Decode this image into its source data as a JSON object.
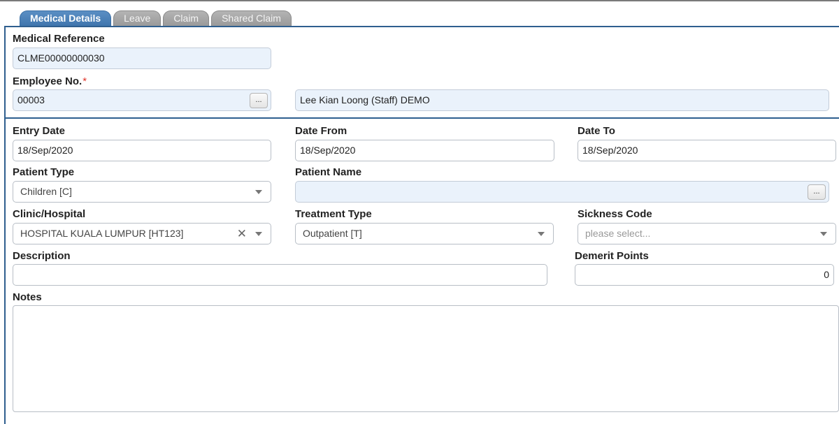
{
  "tabs": [
    {
      "label": "Medical Details",
      "active": true
    },
    {
      "label": "Leave",
      "active": false
    },
    {
      "label": "Claim",
      "active": false
    },
    {
      "label": "Shared Claim",
      "active": false
    }
  ],
  "form": {
    "medical_reference": {
      "label": "Medical Reference",
      "value": "CLME00000000030"
    },
    "employee_no": {
      "label": "Employee No.",
      "required_mark": "*",
      "value": "00003",
      "lookup_label": "...",
      "name_value": "Lee Kian Loong (Staff) DEMO"
    },
    "entry_date": {
      "label": "Entry Date",
      "value": "18/Sep/2020"
    },
    "date_from": {
      "label": "Date From",
      "value": "18/Sep/2020"
    },
    "date_to": {
      "label": "Date To",
      "value": "18/Sep/2020"
    },
    "patient_type": {
      "label": "Patient Type",
      "value": "Children [C]"
    },
    "patient_name": {
      "label": "Patient Name",
      "value": "",
      "lookup_label": "..."
    },
    "clinic_hospital": {
      "label": "Clinic/Hospital",
      "value": "HOSPITAL KUALA LUMPUR [HT123]",
      "clear_glyph": "✕"
    },
    "treatment_type": {
      "label": "Treatment Type",
      "value": "Outpatient [T]"
    },
    "sickness_code": {
      "label": "Sickness Code",
      "placeholder": "please select..."
    },
    "description": {
      "label": "Description",
      "value": ""
    },
    "demerit_points": {
      "label": "Demerit Points",
      "value": "0"
    },
    "notes": {
      "label": "Notes",
      "value": ""
    }
  },
  "colors": {
    "active_tab": "#4a80b8",
    "inactive_tab": "#a8a8a8",
    "panel_border": "#2f5f8f",
    "readonly_field": "#eaf2fb",
    "required": "#e0352b"
  }
}
